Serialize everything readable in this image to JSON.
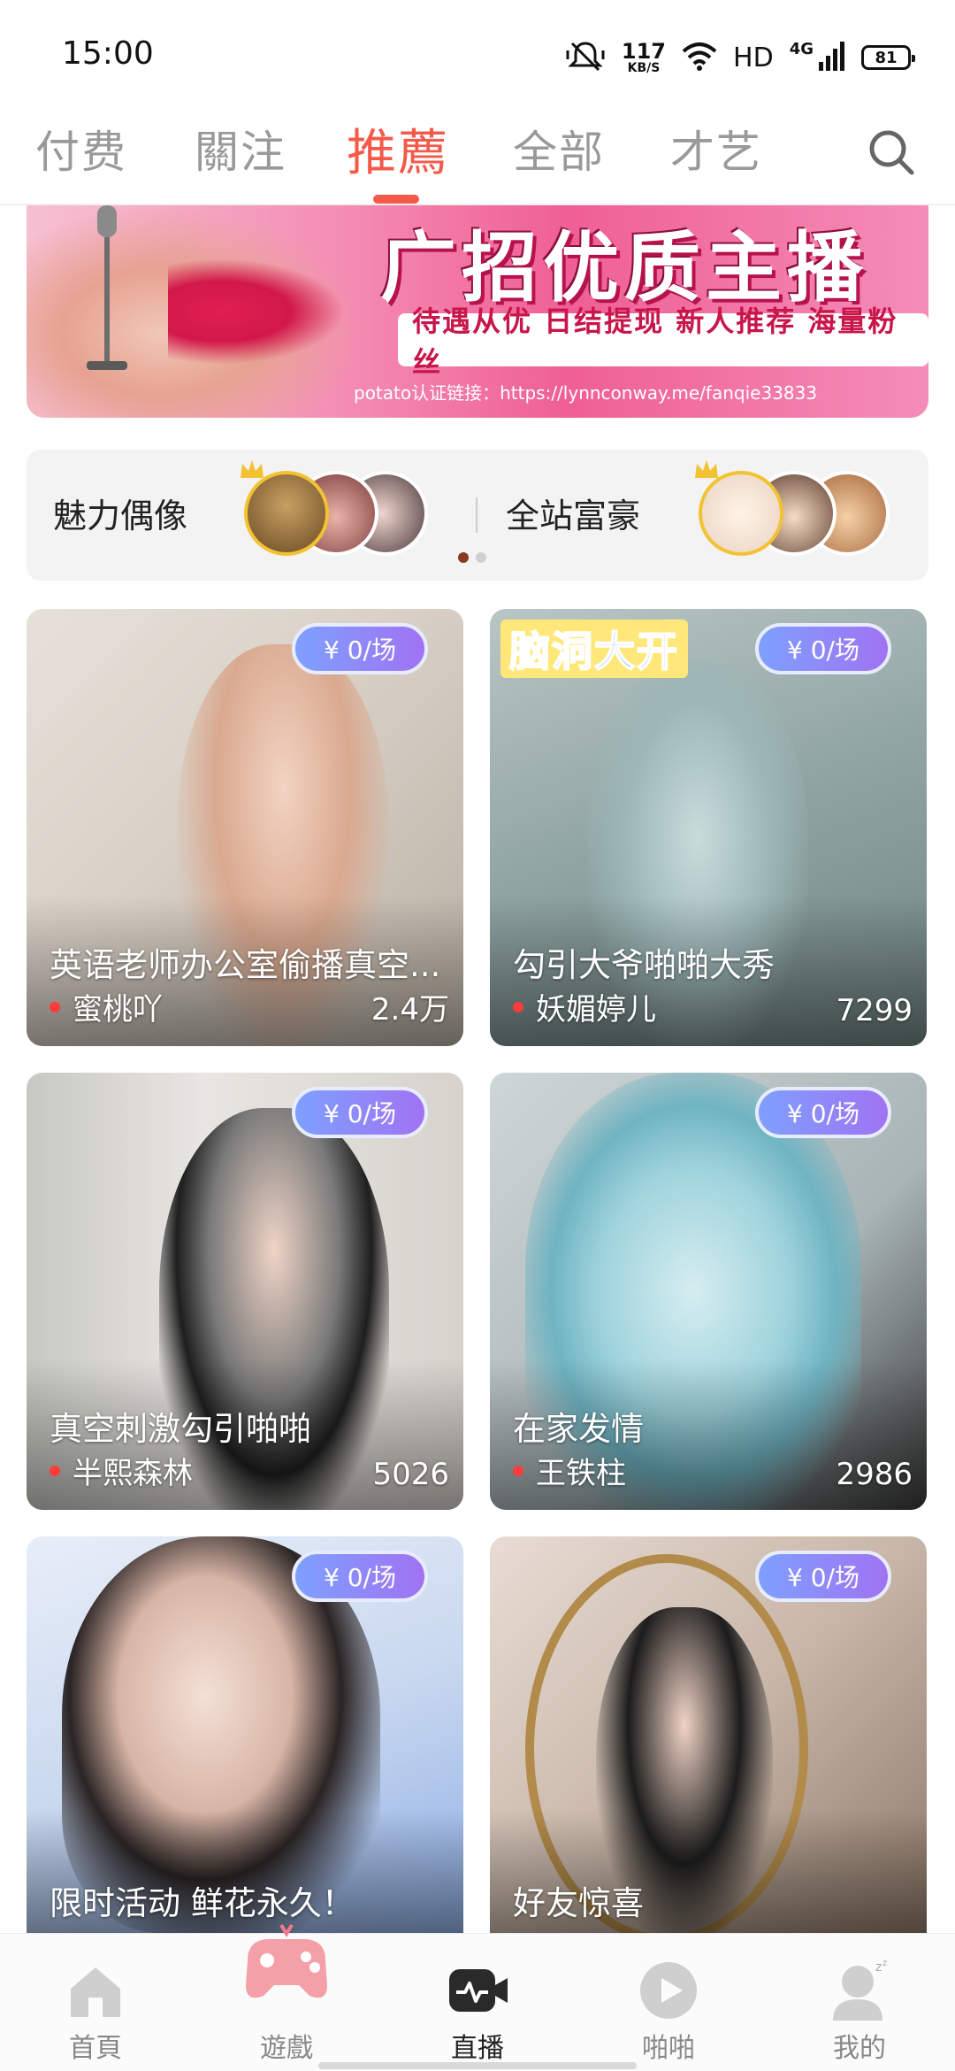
{
  "status": {
    "time": "15:00",
    "speed_value": "117",
    "speed_unit": "KB/S",
    "hd": "HD",
    "network": "4G",
    "battery": "81"
  },
  "tabs": [
    {
      "label": "付费"
    },
    {
      "label": "關注"
    },
    {
      "label": "推薦"
    },
    {
      "label": "全部"
    },
    {
      "label": "才艺"
    }
  ],
  "active_tab": "推薦",
  "banner": {
    "title": "广招优质主播",
    "subtitle": "待遇从优 日结提现 新人推荐 海量粉丝",
    "link": "potato认证链接：https://lynnconway.me/fanqie33833"
  },
  "rankings": {
    "left_label": "魅力偶像",
    "right_label": "全站富豪"
  },
  "cards": [
    {
      "price": "¥ 0/场",
      "title": "英语老师办公室偷播真空...",
      "host": "蜜桃吖",
      "views": "2.4万",
      "tag": ""
    },
    {
      "price": "¥ 0/场",
      "title": "勾引大爷啪啪大秀",
      "host": "妖媚婷儿",
      "views": "7299",
      "tag": "脑洞大开"
    },
    {
      "price": "¥ 0/场",
      "title": "真空刺激勾引啪啪",
      "host": "半熙森林",
      "views": "5026",
      "tag": ""
    },
    {
      "price": "¥ 0/场",
      "title": "在家发情",
      "host": "王铁柱",
      "views": "2986",
      "tag": ""
    },
    {
      "price": "¥ 0/场",
      "title": "限时活动 鲜花永久！",
      "host": "",
      "views": "",
      "tag": ""
    },
    {
      "price": "¥ 0/场",
      "title": "好友惊喜",
      "host": "",
      "views": "",
      "tag": ""
    }
  ],
  "bottom_nav": [
    {
      "label": "首頁",
      "icon": "home-icon"
    },
    {
      "label": "遊戲",
      "icon": "gamepad-icon"
    },
    {
      "label": "直播",
      "icon": "live-icon"
    },
    {
      "label": "啪啪",
      "icon": "play-icon"
    },
    {
      "label": "我的",
      "icon": "profile-icon"
    }
  ],
  "active_nav": "直播",
  "colors": {
    "accent": "#f5594a",
    "price_badge_start": "#7ea0ff",
    "price_badge_end": "#a073f2",
    "live_dot": "#ff3b3b"
  }
}
